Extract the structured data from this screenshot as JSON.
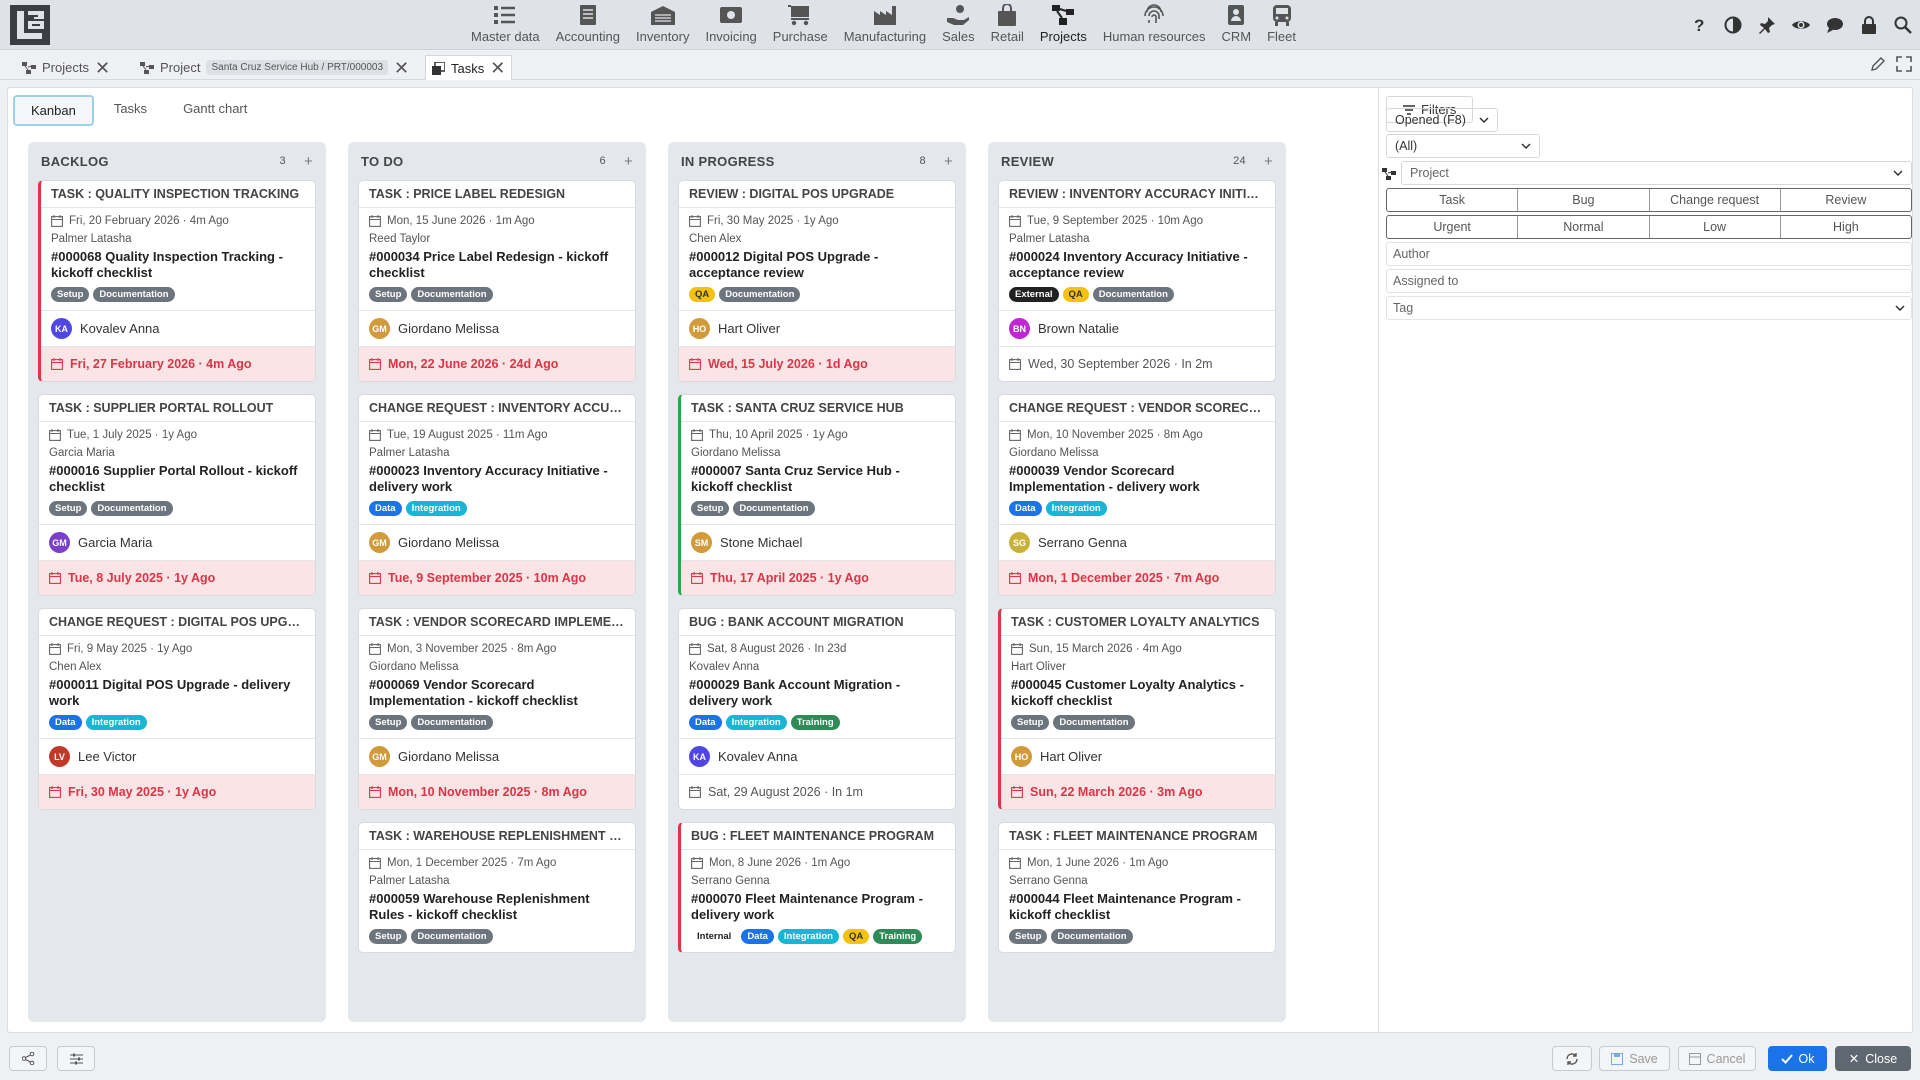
{
  "topnav": {
    "modules": [
      {
        "label": "Master data",
        "icon": "list-icon"
      },
      {
        "label": "Accounting",
        "icon": "ledger-icon"
      },
      {
        "label": "Inventory",
        "icon": "warehouse-icon"
      },
      {
        "label": "Invoicing",
        "icon": "invoice-icon"
      },
      {
        "label": "Purchase",
        "icon": "cart-icon"
      },
      {
        "label": "Manufacturing",
        "icon": "factory-icon"
      },
      {
        "label": "Sales",
        "icon": "hand-coin-icon"
      },
      {
        "label": "Retail",
        "icon": "shopping-bag-icon"
      },
      {
        "label": "Projects",
        "icon": "project-tree-icon",
        "active": true
      },
      {
        "label": "Human resources",
        "icon": "fingerprint-icon"
      },
      {
        "label": "CRM",
        "icon": "badge-icon"
      },
      {
        "label": "Fleet",
        "icon": "bus-icon"
      }
    ]
  },
  "tabs": {
    "projects_label": "Projects",
    "project_label": "Project",
    "project_pill": "Santa Cruz Service Hub / PRT/000003",
    "tasks_label": "Tasks"
  },
  "views": {
    "kanban": "Kanban",
    "tasks": "Tasks",
    "gantt": "Gantt chart"
  },
  "columns": [
    {
      "title": "BACKLOG",
      "count": "3",
      "cards": [
        {
          "title": "TASK : QUALITY INSPECTION TRACKING",
          "border": "red",
          "date": "Fri, 20 February 2026 · 4m Ago",
          "author": "Palmer Latasha",
          "desc": "#000068 Quality Inspection Tracking - kickoff checklist",
          "tags": [
            "Setup",
            "Documentation"
          ],
          "assignee": "Kovalev Anna",
          "initials": "KA",
          "avatar_color": "#4f46e5",
          "due": "Fri, 27 February 2026 · 4m Ago",
          "overdue": true
        },
        {
          "title": "TASK : SUPPLIER PORTAL ROLLOUT",
          "border": "",
          "date": "Tue, 1 July 2025 · 1y Ago",
          "author": "Garcia Maria",
          "desc": "#000016 Supplier Portal Rollout - kickoff checklist",
          "tags": [
            "Setup",
            "Documentation"
          ],
          "assignee": "Garcia Maria",
          "initials": "GM",
          "avatar_color": "#7c3fc9",
          "due": "Tue, 8 July 2025 · 1y Ago",
          "overdue": true
        },
        {
          "title": "CHANGE REQUEST : DIGITAL POS UPGRADE",
          "border": "",
          "date": "Fri, 9 May 2025 · 1y Ago",
          "author": "Chen Alex",
          "desc": "#000011 Digital POS Upgrade - delivery work",
          "tags": [
            "Data",
            "Integration"
          ],
          "assignee": "Lee Victor",
          "initials": "LV",
          "avatar_color": "#c0392b",
          "due": "Fri, 30 May 2025 · 1y Ago",
          "overdue": true
        }
      ]
    },
    {
      "title": "TO DO",
      "count": "6",
      "cards": [
        {
          "title": "TASK : PRICE LABEL REDESIGN",
          "border": "",
          "date": "Mon, 15 June 2026 · 1m Ago",
          "author": "Reed Taylor",
          "desc": "#000034 Price Label Redesign - kickoff checklist",
          "tags": [
            "Setup",
            "Documentation"
          ],
          "assignee": "Giordano Melissa",
          "initials": "GM",
          "avatar_color": "#d19a3a",
          "due": "Mon, 22 June 2026 · 24d Ago",
          "overdue": true
        },
        {
          "title": "CHANGE REQUEST : INVENTORY ACCURACY...",
          "border": "",
          "date": "Tue, 19 August 2025 · 11m Ago",
          "author": "Palmer Latasha",
          "desc": "#000023 Inventory Accuracy Initiative - delivery work",
          "tags": [
            "Data",
            "Integration"
          ],
          "assignee": "Giordano Melissa",
          "initials": "GM",
          "avatar_color": "#d19a3a",
          "due": "Tue, 9 September 2025 · 10m Ago",
          "overdue": true
        },
        {
          "title": "TASK : VENDOR SCORECARD IMPLEMENTA...",
          "border": "",
          "date": "Mon, 3 November 2025 · 8m Ago",
          "author": "Giordano Melissa",
          "desc": "#000069 Vendor Scorecard Implementation - kickoff checklist",
          "tags": [
            "Setup",
            "Documentation"
          ],
          "assignee": "Giordano Melissa",
          "initials": "GM",
          "avatar_color": "#d19a3a",
          "due": "Mon, 10 November 2025 · 8m Ago",
          "overdue": true
        },
        {
          "title": "TASK : WAREHOUSE REPLENISHMENT RULES",
          "border": "",
          "date": "Mon, 1 December 2025 · 7m Ago",
          "author": "Palmer Latasha",
          "desc": "#000059 Warehouse Replenishment Rules - kickoff checklist",
          "tags": [
            "Setup",
            "Documentation"
          ],
          "assignee": "",
          "initials": "",
          "avatar_color": "",
          "due": "",
          "overdue": false
        }
      ]
    },
    {
      "title": "IN PROGRESS",
      "count": "8",
      "cards": [
        {
          "title": "REVIEW : DIGITAL POS UPGRADE",
          "border": "",
          "date": "Fri, 30 May 2025 · 1y Ago",
          "author": "Chen Alex",
          "desc": "#000012 Digital POS Upgrade - acceptance review",
          "tags": [
            "QA",
            "Documentation"
          ],
          "assignee": "Hart Oliver",
          "initials": "HO",
          "avatar_color": "#d19a3a",
          "due": "Wed, 15 July 2026 · 1d Ago",
          "overdue": true
        },
        {
          "title": "TASK : SANTA CRUZ SERVICE HUB",
          "border": "green",
          "date": "Thu, 10 April 2025 · 1y Ago",
          "author": "Giordano Melissa",
          "desc": "#000007 Santa Cruz Service Hub - kickoff checklist",
          "tags": [
            "Setup",
            "Documentation"
          ],
          "assignee": "Stone Michael",
          "initials": "SM",
          "avatar_color": "#d19a3a",
          "due": "Thu, 17 April 2025 · 1y Ago",
          "overdue": true
        },
        {
          "title": "BUG : BANK ACCOUNT MIGRATION",
          "border": "",
          "date": "Sat, 8 August 2026 · In 23d",
          "author": "Kovalev Anna",
          "desc": "#000029 Bank Account Migration - delivery work",
          "tags": [
            "Data",
            "Integration",
            "Training"
          ],
          "assignee": "Kovalev Anna",
          "initials": "KA",
          "avatar_color": "#4f46e5",
          "due": "Sat, 29 August 2026 · In 1m",
          "overdue": false
        },
        {
          "title": "BUG : FLEET MAINTENANCE PROGRAM",
          "border": "red",
          "date": "Mon, 8 June 2026 · 1m Ago",
          "author": "Serrano Genna",
          "desc": "#000070 Fleet Maintenance Program - delivery work",
          "tags": [
            "Internal",
            "Data",
            "Integration",
            "QA",
            "Training"
          ],
          "assignee": "",
          "initials": "",
          "avatar_color": "",
          "due": "",
          "overdue": false
        }
      ]
    },
    {
      "title": "REVIEW",
      "count": "24",
      "cards": [
        {
          "title": "REVIEW : INVENTORY ACCURACY INITIATIVE",
          "border": "",
          "date": "Tue, 9 September 2025 · 10m Ago",
          "author": "Palmer Latasha",
          "desc": "#000024 Inventory Accuracy Initiative - acceptance review",
          "tags": [
            "External",
            "QA",
            "Documentation"
          ],
          "assignee": "Brown Natalie",
          "initials": "BN",
          "avatar_color": "#c026d3",
          "due": "Wed, 30 September 2026 · In 2m",
          "overdue": false
        },
        {
          "title": "CHANGE REQUEST : VENDOR SCORECARD I...",
          "border": "",
          "date": "Mon, 10 November 2025 · 8m Ago",
          "author": "Giordano Melissa",
          "desc": "#000039 Vendor Scorecard Implementation - delivery work",
          "tags": [
            "Data",
            "Integration"
          ],
          "assignee": "Serrano Genna",
          "initials": "SG",
          "avatar_color": "#c9b23a",
          "due": "Mon, 1 December 2025 · 7m Ago",
          "overdue": true
        },
        {
          "title": "TASK : CUSTOMER LOYALTY ANALYTICS",
          "border": "red",
          "date": "Sun, 15 March 2026 · 4m Ago",
          "author": "Hart Oliver",
          "desc": "#000045 Customer Loyalty Analytics - kickoff checklist",
          "tags": [
            "Setup",
            "Documentation"
          ],
          "assignee": "Hart Oliver",
          "initials": "HO",
          "avatar_color": "#d19a3a",
          "due": "Sun, 22 March 2026 · 3m Ago",
          "overdue": true
        },
        {
          "title": "TASK : FLEET MAINTENANCE PROGRAM",
          "border": "",
          "date": "Mon, 1 June 2026 · 1m Ago",
          "author": "Serrano Genna",
          "desc": "#000044 Fleet Maintenance Program - kickoff checklist",
          "tags": [
            "Setup",
            "Documentation"
          ],
          "assignee": "",
          "initials": "",
          "avatar_color": "",
          "due": "",
          "overdue": false
        }
      ]
    }
  ],
  "tag_colors": {
    "Setup": "#6c757d",
    "Documentation": "#6c757d",
    "Data": "#1a73e8",
    "Integration": "#17b6d4",
    "QA": "#f4c20d",
    "Training": "#2e8b57",
    "External": "#222222",
    "Internal": "#ffffff"
  },
  "filters": {
    "header": "Filters",
    "opened": "Opened (F8)",
    "all": "(All)",
    "project_placeholder": "Project",
    "types": [
      "Task",
      "Bug",
      "Change request",
      "Review"
    ],
    "priorities": [
      "Urgent",
      "Normal",
      "Low",
      "High"
    ],
    "author_placeholder": "Author",
    "assigned_placeholder": "Assigned to",
    "tag_placeholder": "Tag"
  },
  "bottom": {
    "save": "Save",
    "cancel": "Cancel",
    "ok": "Ok",
    "close": "Close"
  }
}
